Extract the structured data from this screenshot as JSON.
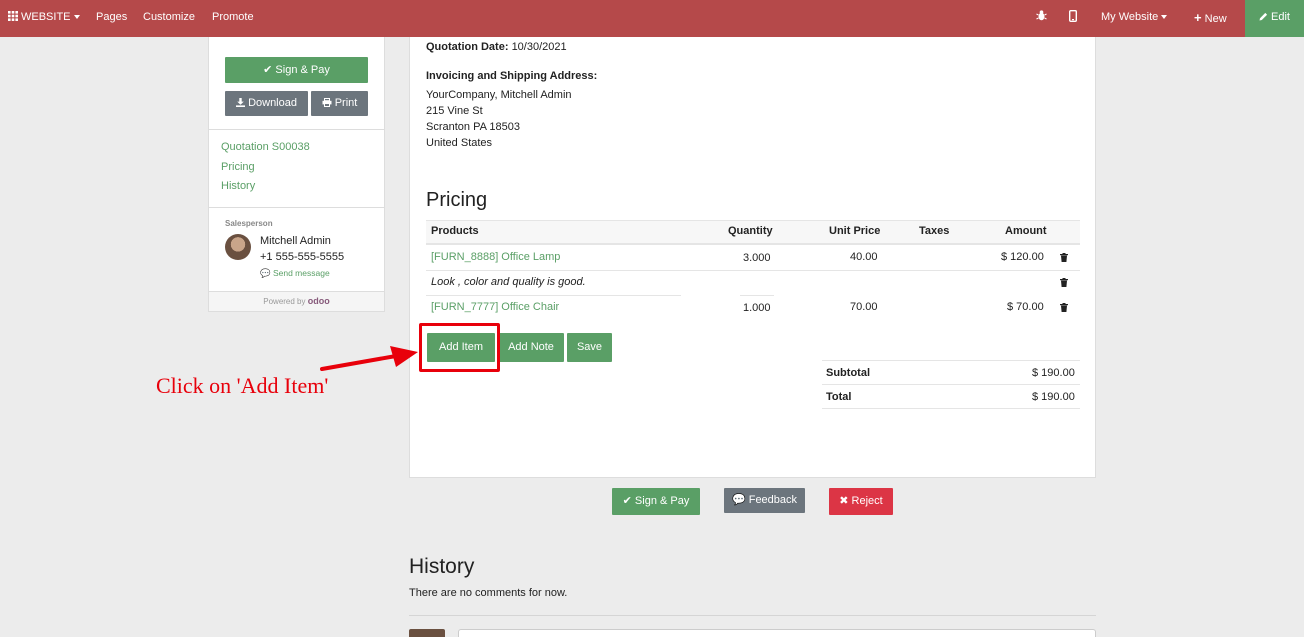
{
  "topbar": {
    "website": "WEBSITE",
    "pages": "Pages",
    "customize": "Customize",
    "promote": "Promote",
    "my_website": "My Website",
    "new": "New",
    "edit": "Edit"
  },
  "sidebar": {
    "sign_pay": "Sign & Pay",
    "download": "Download",
    "print": "Print",
    "links": [
      "Quotation S00038",
      "Pricing",
      "History"
    ],
    "salesperson_label": "Salesperson",
    "salesperson_name": "Mitchell Admin",
    "salesperson_phone": "+1 555-555-5555",
    "send_message": "Send message",
    "powered_by": "Powered by",
    "brand": "odoo"
  },
  "quotation": {
    "date_label": "Quotation Date:",
    "date_value": "10/30/2021",
    "address_label": "Invoicing and Shipping Address:",
    "address_lines": [
      "YourCompany, Mitchell Admin",
      "215 Vine St",
      "Scranton PA 18503",
      "United States"
    ]
  },
  "pricing": {
    "title": "Pricing",
    "columns": [
      "Products",
      "Quantity",
      "Unit Price",
      "Taxes",
      "Amount"
    ],
    "rows": [
      {
        "product": "[FURN_8888] Office Lamp",
        "quantity": "3.000",
        "unit_price": "40.00",
        "amount": "$ 120.00"
      },
      {
        "note": "Look , color and quality is good."
      },
      {
        "product": "[FURN_7777] Office Chair",
        "quantity": "1.000",
        "unit_price": "70.00",
        "amount": "$ 70.00"
      }
    ],
    "add_item": "Add Item",
    "add_note": "Add Note",
    "save": "Save",
    "subtotal_label": "Subtotal",
    "subtotal_value": "$ 190.00",
    "total_label": "Total",
    "total_value": "$ 190.00"
  },
  "actions": {
    "sign_pay": "Sign & Pay",
    "feedback": "Feedback",
    "reject": "Reject"
  },
  "history": {
    "title": "History",
    "empty": "There are no comments for now."
  },
  "annotation": {
    "text": "Click on 'Add Item'",
    "color": "#e8000b"
  },
  "colors": {
    "topbar": "#b5494a",
    "accent_green": "#5a9f66",
    "grey_button": "#6c757d",
    "reject_red": "#dc3545"
  }
}
